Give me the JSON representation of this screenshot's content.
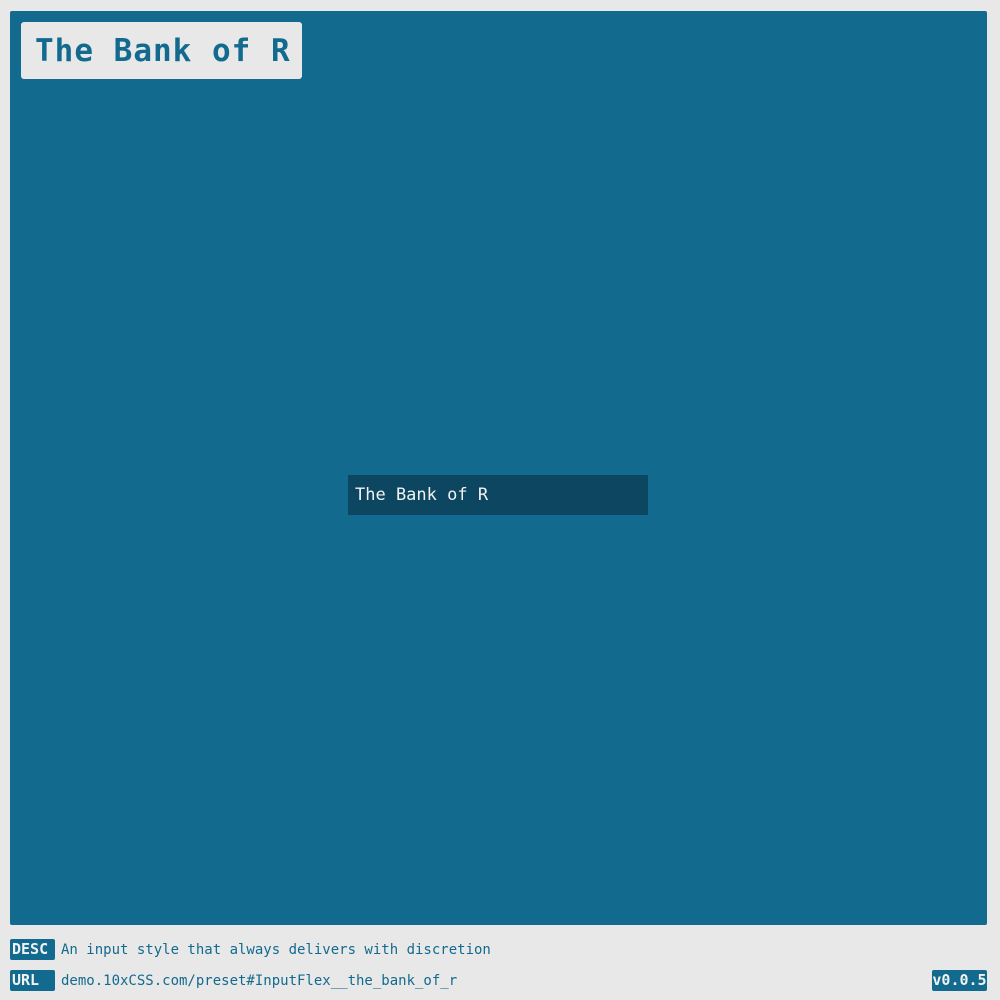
{
  "header": {
    "title": "The Bank of R"
  },
  "demo": {
    "input_value": "The Bank of R"
  },
  "footer": {
    "desc_tag": "DESC",
    "desc_text": "An input style that always delivers with discretion",
    "url_tag": "URL",
    "url_text": "demo.10xCSS.com/preset#InputFlex__the_bank_of_r",
    "version": "v0.0.5"
  },
  "colors": {
    "accent": "#126a8e",
    "input_background": "#0c4661",
    "page_background": "#e8e8e8",
    "light_text": "#f2f2f2"
  }
}
